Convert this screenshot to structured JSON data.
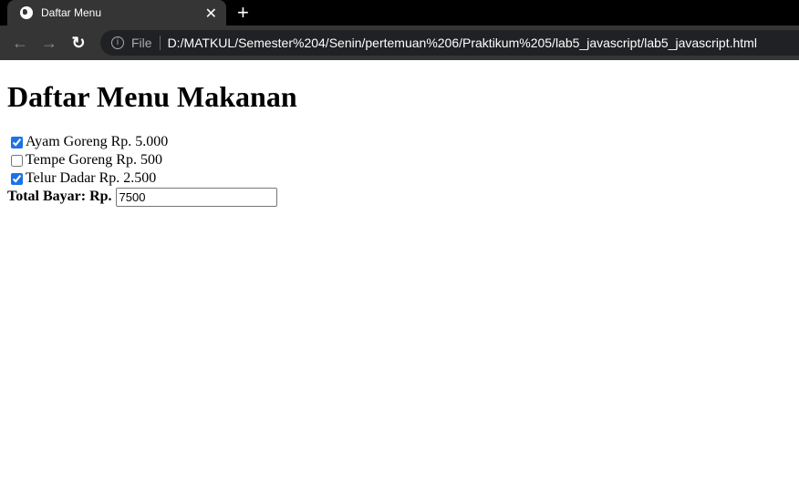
{
  "browser": {
    "tab_title": "Daftar Menu",
    "address_prefix": "File",
    "url": "D:/MATKUL/Semester%204/Senin/pertemuan%206/Praktikum%205/lab5_javascript/lab5_javascript.html"
  },
  "page": {
    "title": "Daftar Menu Makanan",
    "items": [
      {
        "label": "Ayam Goreng Rp. 5.000",
        "checked": true
      },
      {
        "label": "Tempe Goreng Rp. 500",
        "checked": false
      },
      {
        "label": "Telur Dadar Rp. 2.500",
        "checked": true
      }
    ],
    "total_label": "Total Bayar: Rp.",
    "total_value": "7500"
  }
}
